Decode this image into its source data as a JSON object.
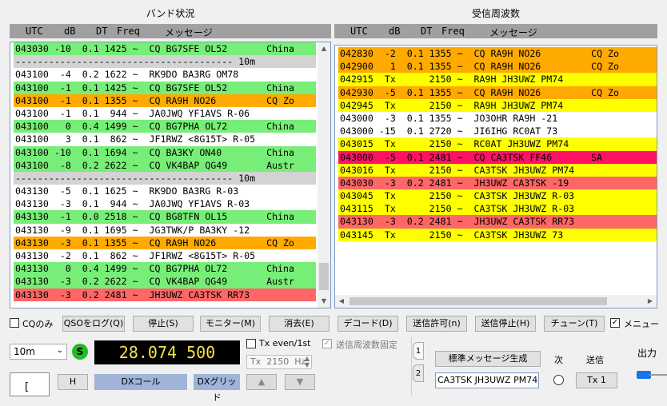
{
  "left_panel": {
    "title": "バンド状況",
    "columns": [
      "UTC",
      "dB",
      "DT",
      "Freq",
      "メッセージ"
    ],
    "rows": [
      {
        "text": "043030 -10  0.1 1425 ~  CQ BG7SFE OL52       China",
        "bg": "#77ee77"
      },
      {
        "text": "--------------------------------------- 10m",
        "bg": "#d3d3d3"
      },
      {
        "text": "043100  -4  0.2 1622 ~  RK9DO BA3RG OM78",
        "bg": "#ffffff"
      },
      {
        "text": "043100  -1  0.1 1425 ~  CQ BG7SFE OL52       China",
        "bg": "#77ee77"
      },
      {
        "text": "043100  -1  0.1 1355 ~  CQ RA9H NO26         CQ Zo",
        "bg": "#ffaa00"
      },
      {
        "text": "043100  -1  0.1  944 ~  JA0JWQ YF1AVS R-06",
        "bg": "#ffffff"
      },
      {
        "text": "043100   0  0.4 1499 ~  CQ BG7PHA OL72       China",
        "bg": "#77ee77"
      },
      {
        "text": "043100   3  0.1  862 ~  JF1RWZ <8G15T> R-05",
        "bg": "#ffffff"
      },
      {
        "text": "043100 -10  0.1 1694 ~  CQ BA3KY ON40        China",
        "bg": "#77ee77"
      },
      {
        "text": "043100  -8  0.2 2622 ~  CQ VK4BAP QG49       Austr",
        "bg": "#77ee77"
      },
      {
        "text": "--------------------------------------- 10m",
        "bg": "#d3d3d3"
      },
      {
        "text": "043130  -5  0.1 1625 ~  RK9DO BA3RG R-03",
        "bg": "#ffffff"
      },
      {
        "text": "043130  -3  0.1  944 ~  JA0JWQ YF1AVS R-03",
        "bg": "#ffffff"
      },
      {
        "text": "043130  -1  0.0 2518 ~  CQ BG8TFN OL15       China",
        "bg": "#77ee77"
      },
      {
        "text": "043130  -9  0.1 1695 ~  JG3TWK/P BA3KY -12",
        "bg": "#ffffff"
      },
      {
        "text": "043130  -3  0.1 1355 ~  CQ RA9H NO26         CQ Zo",
        "bg": "#ffaa00"
      },
      {
        "text": "043130  -2  0.1  862 ~  JF1RWZ <8G15T> R-05",
        "bg": "#ffffff"
      },
      {
        "text": "043130   0  0.4 1499 ~  CQ BG7PHA OL72       China",
        "bg": "#77ee77"
      },
      {
        "text": "043130  -3  0.2 2622 ~  CQ VK4BAP QG49       Austr",
        "bg": "#77ee77"
      },
      {
        "text": "043130  -3  0.2 2481 ~  JH3UWZ CA3TSK RR73",
        "bg": "#ff6666"
      }
    ]
  },
  "right_panel": {
    "title": "受信周波数",
    "columns": [
      "UTC",
      "dB",
      "DT",
      "Freq",
      "メッセージ"
    ],
    "rows": [
      {
        "text": "042830  -2  0.1 1355 ~  CQ RA9H NO26         CQ Zo",
        "bg": "#ffaa00"
      },
      {
        "text": "042900   1  0.1 1355 ~  CQ RA9H NO26         CQ Zo",
        "bg": "#ffaa00"
      },
      {
        "text": "042915  Tx      2150 ~  RA9H JH3UWZ PM74",
        "bg": "#ffff00"
      },
      {
        "text": "042930  -5  0.1 1355 ~  CQ RA9H NO26         CQ Zo",
        "bg": "#ffaa00"
      },
      {
        "text": "042945  Tx      2150 ~  RA9H JH3UWZ PM74",
        "bg": "#ffff00"
      },
      {
        "text": "043000  -3  0.1 1355 ~  JO3OHR RA9H -21",
        "bg": "#ffffff"
      },
      {
        "text": "043000 -15  0.1 2720 ~  JI6IHG RC0AT 73",
        "bg": "#ffffff"
      },
      {
        "text": "043015  Tx      2150 ~  RC0AT JH3UWZ PM74",
        "bg": "#ffff00"
      },
      {
        "text": "043000  -5  0.1 2481 ~  CQ CA3TSK FF46       SA",
        "bg": "#ff1166"
      },
      {
        "text": "043016  Tx      2150 ~  CA3TSK JH3UWZ PM74",
        "bg": "#ffff00"
      },
      {
        "text": "043030  -3  0.2 2481 ~  JH3UWZ CA3TSK -19",
        "bg": "#ff6666"
      },
      {
        "text": "043045  Tx      2150 ~  CA3TSK JH3UWZ R-03",
        "bg": "#ffff00"
      },
      {
        "text": "043115  Tx      2150 ~  CA3TSK JH3UWZ R-03",
        "bg": "#ffff00"
      },
      {
        "text": "043130  -3  0.2 2481 ~  JH3UWZ CA3TSK RR73",
        "bg": "#ff6666"
      },
      {
        "text": "043145  Tx      2150 ~  CA3TSK JH3UWZ 73",
        "bg": "#ffff00"
      }
    ]
  },
  "controls": {
    "cq_only_label": "CQのみ",
    "buttons": {
      "log_qso": "QSOをログ(Q)",
      "stop": "停止(S)",
      "monitor": "モニター(M)",
      "erase": "消去(E)",
      "decode": "デコード(D)",
      "enable_tx": "送信許可(n)",
      "halt_tx": "送信停止(H)",
      "tune": "チューン(T)"
    },
    "menu_label": "メニュー",
    "band": "10m",
    "s_indicator": "S",
    "frequency": "28.074 500",
    "tx_even_label": "Tx even/1st",
    "tx_hz_value": "Tx  2150  Hz",
    "hold_tx_freq_label": "送信周波数固定",
    "h_button": "H",
    "dx_call_label": "DXコール",
    "dx_grid_label": "DXグリッド",
    "output_label": "出力",
    "tabs": [
      "1",
      "2"
    ]
  },
  "messages": {
    "generate_std": "標準メッセージ生成",
    "next_label": "次",
    "send_label": "送信",
    "tx1_message": "CA3TSK JH3UWZ PM74",
    "tx1_button": "Tx 1"
  },
  "colors": {
    "cq": "#77ee77",
    "cq_pota": "#ffaa00",
    "tx": "#ffff00",
    "to_me": "#ff6666",
    "new_dxcc": "#ff1166",
    "separator": "#d3d3d3",
    "freq_bg": "#000000",
    "freq_fg": "#ffff00",
    "dx_call_bg": "#9fb4d8"
  }
}
